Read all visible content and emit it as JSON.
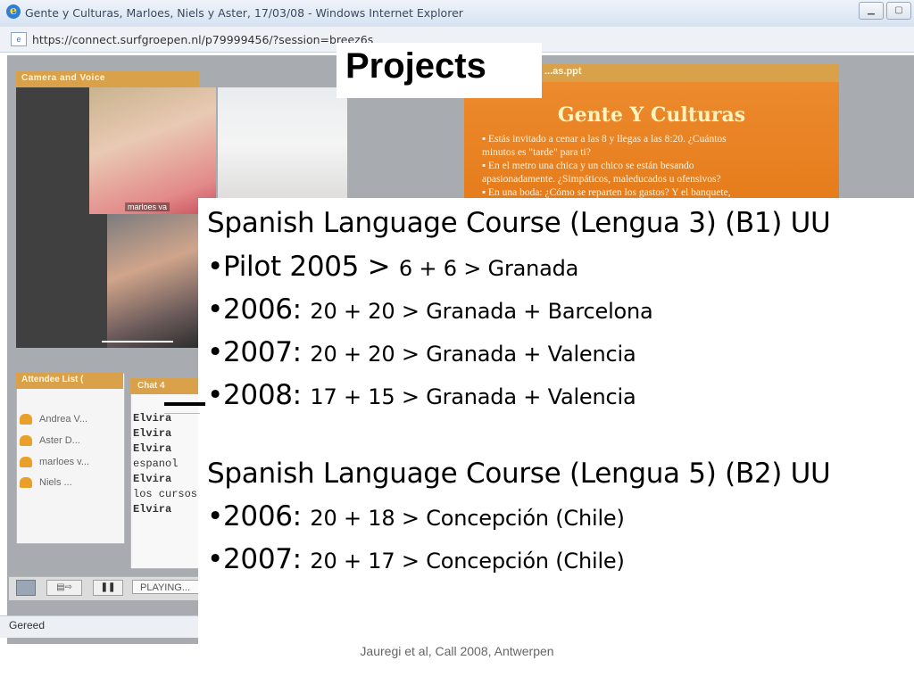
{
  "browser": {
    "window_title": "Gente y Culturas, Marloes, Niels y Aster, 17/03/08 - Windows Internet Explorer",
    "url": "https://connect.surfgroepen.nl/p79999456/?session=breez6s",
    "status_text": "Gereed"
  },
  "meeting": {
    "camera_panel_title": "Camera and Voice",
    "camera_name_1": "marloes va",
    "ppt_panel_title": "...as.ppt",
    "ppt_heading": "Gente Y Culturas",
    "ppt_bullets": [
      "▪ Estás invitado a cenar a las 8 y llegas a las 8:20. ¿Cuántos",
      "   minutos es \"tarde\" para ti?",
      "▪ En el metro una chica y un chico se están besando",
      "   apasionadamente. ¿Simpáticos, maleducados u ofensivos?",
      "▪ En una boda: ¿Cómo se reparten los gastos? Y el banquete,"
    ],
    "attendee_panel_title": "Attendee List (",
    "attendees": [
      "Andrea V...",
      "Aster D...",
      "marloes v...",
      "Niels ..."
    ],
    "chat_panel_title": "Chat 4",
    "chat_lines": [
      "Elvira",
      "Elvira",
      "Elvira",
      "espanol",
      "Elvira",
      " los cursos",
      "Elvira"
    ],
    "playing_label": "PLAYING..."
  },
  "slide": {
    "title": "Projects",
    "section1": {
      "heading": "Spanish Language Course (Lengua 3) (B1) UU",
      "items": [
        {
          "lead": "•Pilot 2005 > ",
          "detail": "6 + 6  > Granada"
        },
        {
          "lead": "•2006: ",
          "detail": "20 + 20 > Granada + Barcelona"
        },
        {
          "lead": "•2007: ",
          "detail": "20 + 20 > Granada + Valencia"
        },
        {
          "lead": "•2008: ",
          "detail": "17 + 15 > Granada + Valencia"
        }
      ]
    },
    "section2": {
      "heading": "Spanish Language Course (Lengua 5) (B2) UU",
      "items": [
        {
          "lead": "•2006: ",
          "detail": "20 + 18 > Concepción (Chile)"
        },
        {
          "lead": "•2007: ",
          "detail": "20 + 17 >  Concepción (Chile)"
        }
      ]
    },
    "footer": "Jauregi et al, Call 2008, Antwerpen"
  }
}
